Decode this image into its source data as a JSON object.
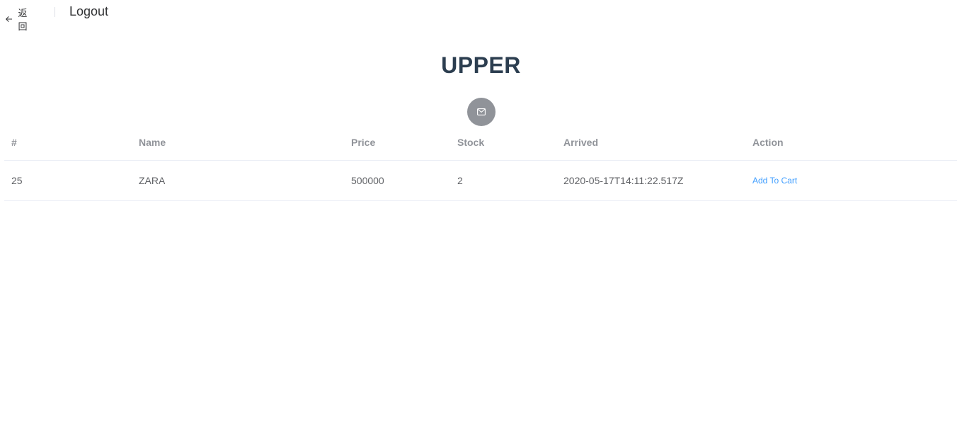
{
  "header": {
    "back_label": "返回",
    "title": "Logout"
  },
  "store": {
    "title": "UPPER",
    "mail_icon": "envelope-icon",
    "mail_button_color": "#909399"
  },
  "table": {
    "columns": [
      "#",
      "Name",
      "Price",
      "Stock",
      "Arrived",
      "Action"
    ],
    "rows": [
      {
        "id": "25",
        "name": "ZARA",
        "price": "500000",
        "stock": "2",
        "arrived": "2020-05-17T14:11:22.517Z",
        "action": "Add To Cart"
      }
    ]
  },
  "colors": {
    "accent": "#409eff",
    "title": "#2c3e50"
  }
}
